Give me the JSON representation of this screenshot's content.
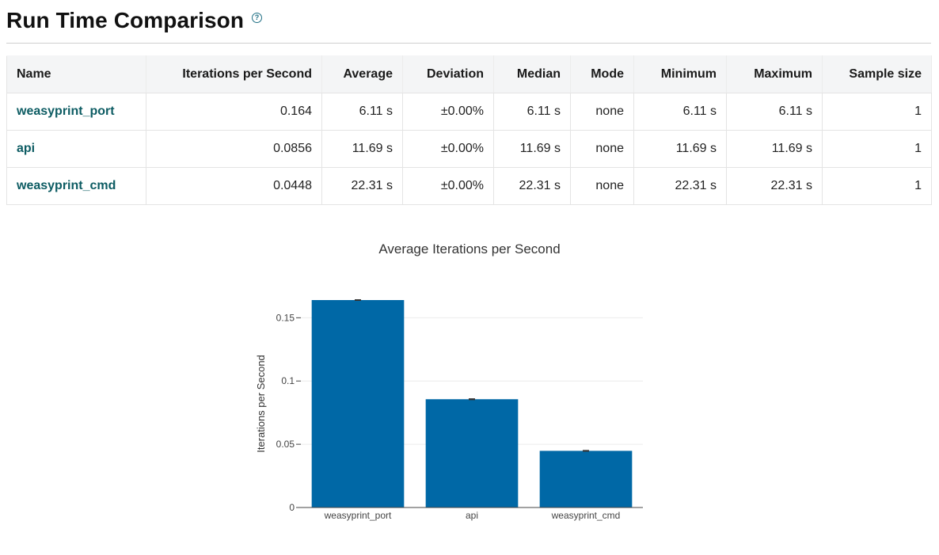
{
  "header": {
    "title": "Run Time Comparison",
    "help_icon": "question-circle-icon"
  },
  "table": {
    "columns": [
      "Name",
      "Iterations per Second",
      "Average",
      "Deviation",
      "Median",
      "Mode",
      "Minimum",
      "Maximum",
      "Sample size"
    ],
    "rows": [
      [
        "weasyprint_port",
        "0.164",
        "6.11 s",
        "±0.00%",
        "6.11 s",
        "none",
        "6.11 s",
        "6.11 s",
        "1"
      ],
      [
        "api",
        "0.0856",
        "11.69 s",
        "±0.00%",
        "11.69 s",
        "none",
        "11.69 s",
        "11.69 s",
        "1"
      ],
      [
        "weasyprint_cmd",
        "0.0448",
        "22.31 s",
        "±0.00%",
        "22.31 s",
        "none",
        "22.31 s",
        "22.31 s",
        "1"
      ]
    ]
  },
  "chart_data": {
    "type": "bar",
    "title": "Average Iterations per Second",
    "xlabel": "",
    "ylabel": "Iterations per Second",
    "categories": [
      "weasyprint_port",
      "api",
      "weasyprint_cmd"
    ],
    "values": [
      0.164,
      0.0856,
      0.0448
    ],
    "error": [
      0,
      0,
      0
    ],
    "ylim": [
      0,
      0.164
    ],
    "yticks": [
      0,
      0.05,
      0.1,
      0.15
    ],
    "ytick_labels": [
      "0",
      "0.05",
      "0.1",
      "0.15"
    ],
    "grid": true,
    "legend": "none",
    "bar_color": "#0068a6",
    "error_bar_color": "#333333"
  }
}
